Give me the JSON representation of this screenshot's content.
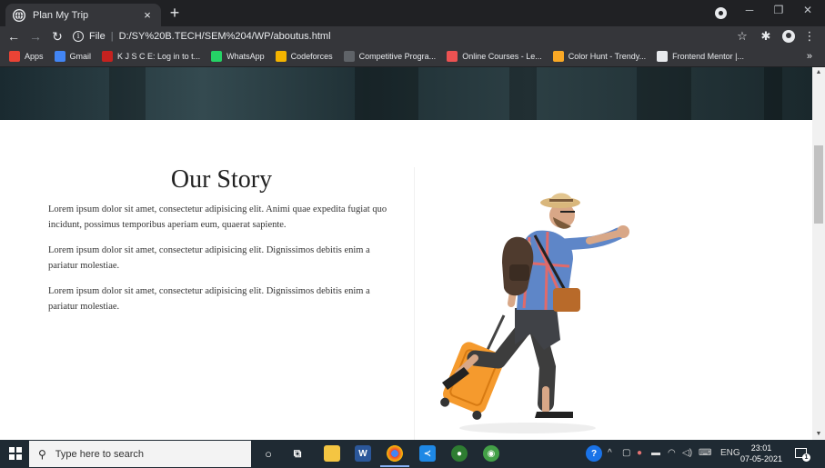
{
  "browser": {
    "tab": {
      "title": "Plan My Trip",
      "close_label": "×"
    },
    "new_tab_label": "+",
    "address": {
      "scheme_label": "File",
      "url": "D:/SY%20B.TECH/SEM%204/WP/aboutus.html"
    },
    "bookmarks": [
      {
        "label": "Apps",
        "icon": "apps-icon",
        "color": "#ea4335"
      },
      {
        "label": "Gmail",
        "icon": "google-icon",
        "color": "#4285f4"
      },
      {
        "label": "K J S C E: Log in to t...",
        "icon": "kjsce-icon",
        "color": "#c5221f"
      },
      {
        "label": "WhatsApp",
        "icon": "whatsapp-icon",
        "color": "#25d366"
      },
      {
        "label": "Codeforces",
        "icon": "codeforces-icon",
        "color": "#f4b400"
      },
      {
        "label": "Competitive Progra...",
        "icon": "cc-icon",
        "color": "#5f6368"
      },
      {
        "label": "Online Courses - Le...",
        "icon": "udemy-icon",
        "color": "#ec5252"
      },
      {
        "label": "Color Hunt - Trendy...",
        "icon": "colorhunt-icon",
        "color": "#f9a825"
      },
      {
        "label": "Frontend Mentor |...",
        "icon": "frontendmentor-icon",
        "color": "#e8eaed"
      }
    ],
    "bookmarks_overflow": "»"
  },
  "page": {
    "heading": "Our Story",
    "paragraphs": [
      "Lorem ipsum dolor sit amet, consectetur adipisicing elit. Animi quae expedita fugiat quo incidunt, possimus temporibus aperiam eum, quaerat sapiente.",
      "Lorem ipsum dolor sit amet, consectetur adipisicing elit. Dignissimos debitis enim a pariatur molestiae.",
      "Lorem ipsum dolor sit amet, consectetur adipisicing elit. Dignissimos debitis enim a pariatur molestiae."
    ]
  },
  "taskbar": {
    "search_placeholder": "Type here to search",
    "language": "ENG",
    "time": "23:01",
    "date": "07-05-2021",
    "notification_count": "1"
  }
}
